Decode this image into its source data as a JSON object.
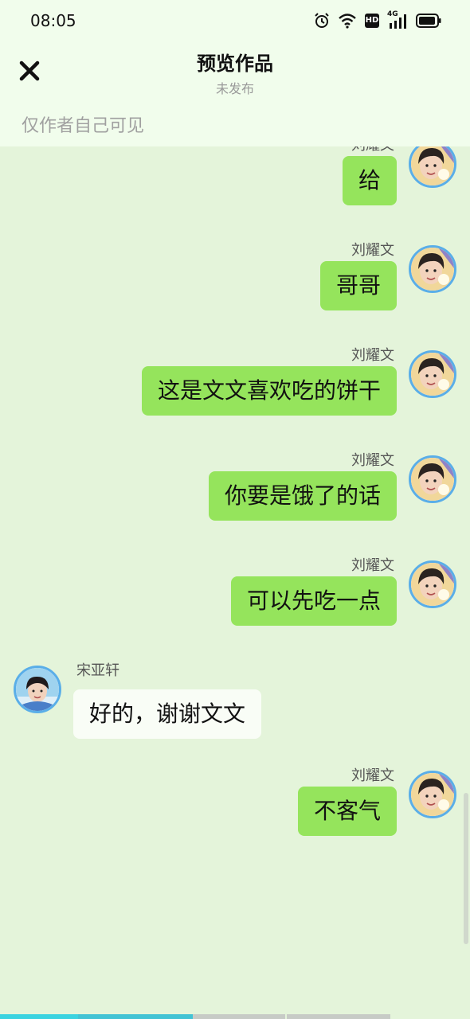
{
  "status_bar": {
    "time": "08:05",
    "network": "4G",
    "hd": "HD"
  },
  "header": {
    "title": "预览作品",
    "subtitle": "未发布",
    "visibility_note": "仅作者自己可见"
  },
  "messages": [
    {
      "sender": "刘耀文",
      "side": "right",
      "text": "给"
    },
    {
      "sender": "刘耀文",
      "side": "right",
      "text": "哥哥"
    },
    {
      "sender": "刘耀文",
      "side": "right",
      "text": "这是文文喜欢吃的饼干"
    },
    {
      "sender": "刘耀文",
      "side": "right",
      "text": "你要是饿了的话"
    },
    {
      "sender": "刘耀文",
      "side": "right",
      "text": "可以先吃一点"
    },
    {
      "sender": "宋亚轩",
      "side": "left",
      "text": "好的，谢谢文文"
    },
    {
      "sender": "刘耀文",
      "side": "right",
      "text": "不客气"
    }
  ],
  "colors": {
    "chat_background": "#e4f4da",
    "header_background": "#f1fdec",
    "right_bubble": "#95e45c",
    "left_bubble": "#f9fdf6",
    "avatar_ring": "#5aaee8"
  }
}
